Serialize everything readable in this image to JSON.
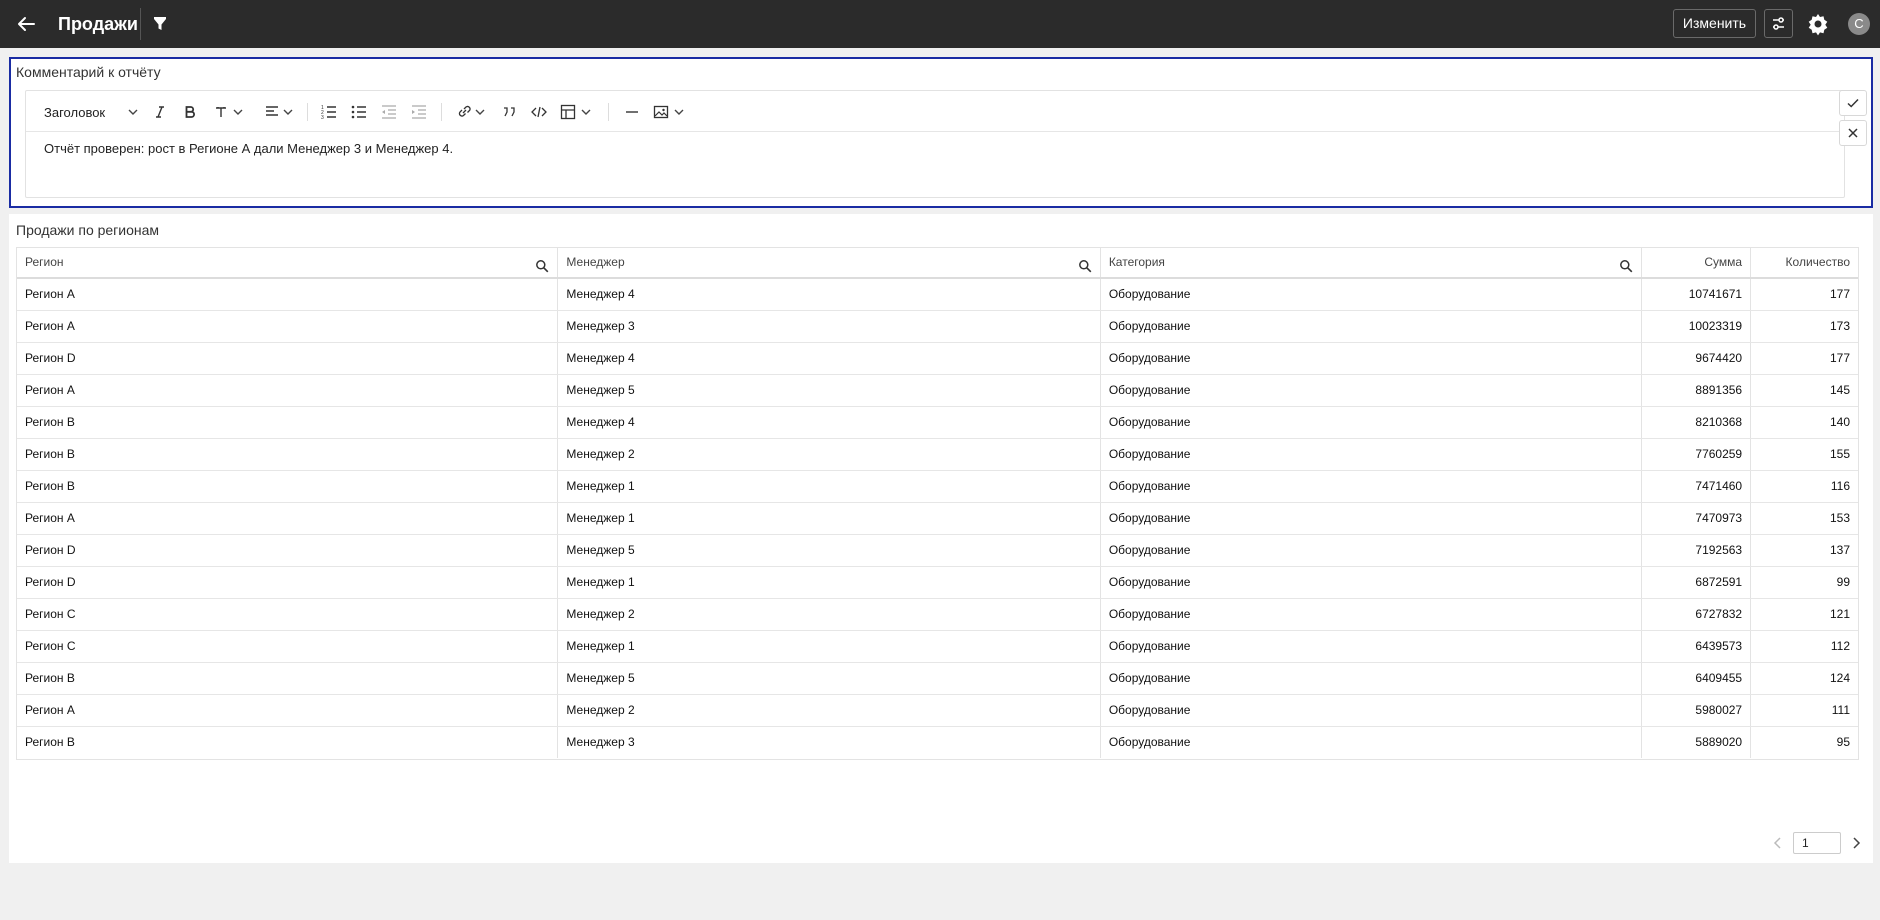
{
  "header": {
    "title": "Продажи",
    "edit_label": "Изменить",
    "avatar_initial": "С"
  },
  "comment": {
    "title": "Комментарий к отчёту",
    "toolbar": {
      "heading_label": "Заголовок"
    },
    "text": "Отчёт проверен: рост в Регионе А дали Менеджер 3 и Менеджер 4."
  },
  "table": {
    "title": "Продажи по регионам",
    "columns": [
      "Регион",
      "Менеджер",
      "Категория",
      "Сумма",
      "Количество"
    ],
    "rows": [
      [
        "Регион A",
        "Менеджер 4",
        "Оборудование",
        "10741671",
        "177"
      ],
      [
        "Регион A",
        "Менеджер 3",
        "Оборудование",
        "10023319",
        "173"
      ],
      [
        "Регион D",
        "Менеджер 4",
        "Оборудование",
        "9674420",
        "177"
      ],
      [
        "Регион A",
        "Менеджер 5",
        "Оборудование",
        "8891356",
        "145"
      ],
      [
        "Регион B",
        "Менеджер 4",
        "Оборудование",
        "8210368",
        "140"
      ],
      [
        "Регион B",
        "Менеджер 2",
        "Оборудование",
        "7760259",
        "155"
      ],
      [
        "Регион B",
        "Менеджер 1",
        "Оборудование",
        "7471460",
        "116"
      ],
      [
        "Регион A",
        "Менеджер 1",
        "Оборудование",
        "7470973",
        "153"
      ],
      [
        "Регион D",
        "Менеджер 5",
        "Оборудование",
        "7192563",
        "137"
      ],
      [
        "Регион D",
        "Менеджер 1",
        "Оборудование",
        "6872591",
        "99"
      ],
      [
        "Регион C",
        "Менеджер 2",
        "Оборудование",
        "6727832",
        "121"
      ],
      [
        "Регион C",
        "Менеджер 1",
        "Оборудование",
        "6439573",
        "112"
      ],
      [
        "Регион B",
        "Менеджер 5",
        "Оборудование",
        "6409455",
        "124"
      ],
      [
        "Регион A",
        "Менеджер 2",
        "Оборудование",
        "5980027",
        "111"
      ],
      [
        "Регион B",
        "Менеджер 3",
        "Оборудование",
        "5889020",
        "95"
      ]
    ]
  },
  "pagination": {
    "page": "1"
  },
  "icons": {
    "back": "arrow-left-icon",
    "filter": "funnel-icon",
    "sliders": "sliders-icon",
    "settings": "gear-icon",
    "search": "search-icon"
  },
  "colors": {
    "topbar": "#2b2b2b",
    "panel_border": "#1a2ca3",
    "page_bg": "#f0f0f0"
  }
}
